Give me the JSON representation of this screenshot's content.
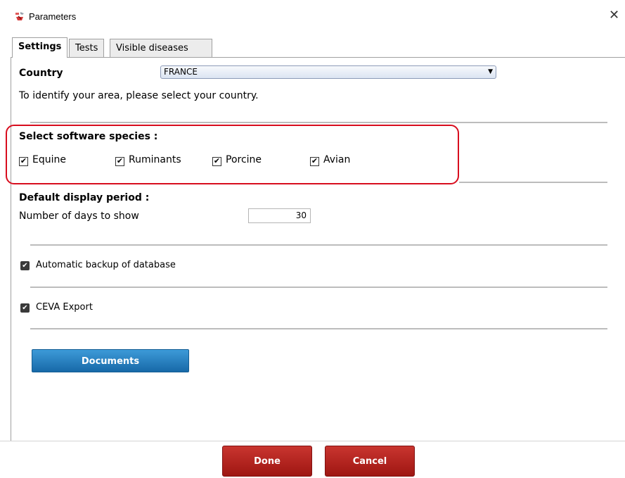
{
  "window": {
    "title": "Parameters"
  },
  "tabs": [
    {
      "label": "Settings",
      "active": true
    },
    {
      "label": "Tests",
      "active": false
    },
    {
      "label": "Visible diseases",
      "active": false
    }
  ],
  "country": {
    "label": "Country",
    "selected": "FRANCE",
    "help": "To identify your area, please select your country."
  },
  "species": {
    "heading": "Select software species :",
    "items": [
      {
        "label": "Equine",
        "checked": true
      },
      {
        "label": "Ruminants",
        "checked": true
      },
      {
        "label": "Porcine",
        "checked": true
      },
      {
        "label": "Avian",
        "checked": true
      }
    ]
  },
  "display_period": {
    "heading": "Default display period :",
    "days_label": "Number of days to show",
    "days_value": "30"
  },
  "options": {
    "backup_label": "Automatic backup of database",
    "backup_checked": true,
    "ceva_label": "CEVA Export",
    "ceva_checked": true
  },
  "buttons": {
    "documents": "Documents",
    "done": "Done",
    "cancel": "Cancel"
  },
  "colors": {
    "highlight": "#d80d1e",
    "documents_button": "#1e78bd",
    "action_button": "#b1201b"
  },
  "icons": {
    "check": "✔",
    "checkmark_box": "☑",
    "close": "✕",
    "dropdown_arrow": "▼"
  }
}
